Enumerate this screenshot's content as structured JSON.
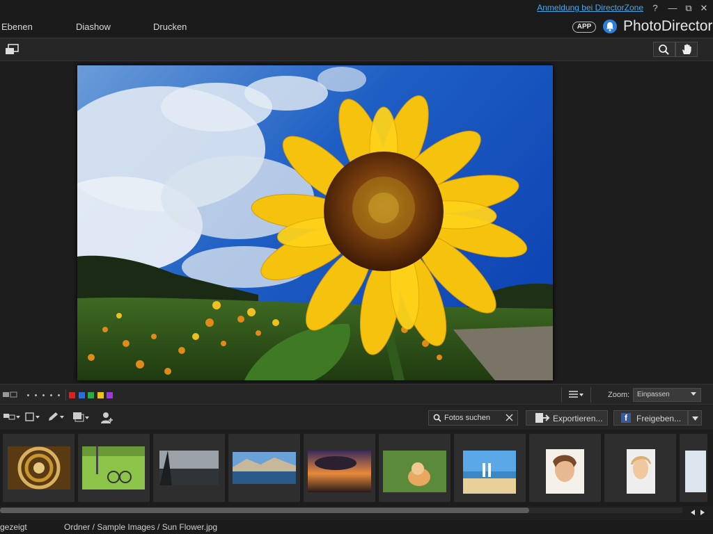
{
  "titlebar": {
    "login_link": "Anmeldung bei DirectorZone",
    "help": "?",
    "minimize": "—",
    "restore": "⧉",
    "close": "✕"
  },
  "menu": {
    "items": [
      "Ebenen",
      "Diashow",
      "Drucken"
    ],
    "app_badge": "APP",
    "brand": "PhotoDirector"
  },
  "labels": {
    "color_swatches": [
      "#e02020",
      "#2a6fe0",
      "#2ea84a",
      "#e8c020",
      "#9a3ad8"
    ]
  },
  "zoom": {
    "label": "Zoom:",
    "value": "Einpassen"
  },
  "actions": {
    "search_label": "Fotos suchen",
    "export_label": "Exportieren...",
    "share_label": "Freigeben..."
  },
  "filmstrip": {
    "thumbnails": [
      "spiral-staircase",
      "bicycle-field",
      "dark-lake",
      "mountain-lake",
      "sunset-sea",
      "cat-grass",
      "beach-couple",
      "smiling-woman",
      "laughing-woman",
      "partial-image"
    ]
  },
  "status": {
    "left": "gezeigt",
    "path": "Ordner / Sample Images / Sun Flower.jpg"
  }
}
